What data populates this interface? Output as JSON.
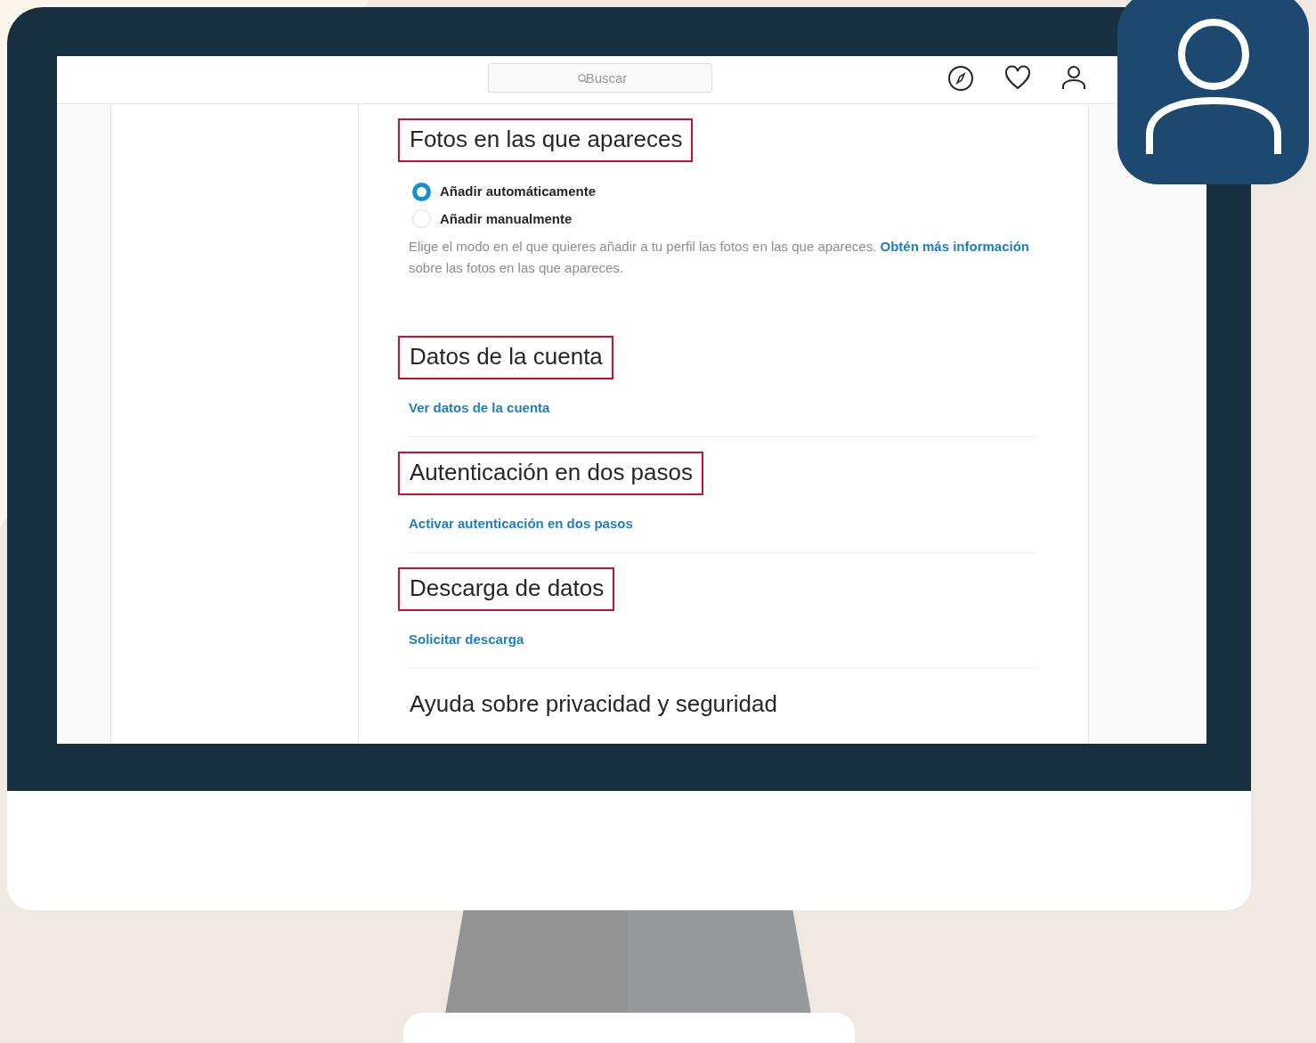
{
  "header": {
    "search": {
      "placeholder": "Buscar"
    }
  },
  "sections": [
    {
      "kind": "radio",
      "title": "Fotos en las que apareces",
      "highlighted": true,
      "options": [
        {
          "label": "Añadir automáticamente",
          "selected": true
        },
        {
          "label": "Añadir manualmente",
          "selected": false
        }
      ],
      "description": {
        "before": "Elige el modo en el que quieres añadir a tu perfil las fotos en las que apareces.",
        "link": "Obtén más información",
        "after": "sobre las fotos en las que apareces."
      }
    },
    {
      "kind": "link",
      "title": "Datos de la cuenta",
      "highlighted": true,
      "link": "Ver datos de la cuenta"
    },
    {
      "kind": "link",
      "title": "Autenticación en dos pasos",
      "highlighted": true,
      "link": "Activar autenticación en dos pasos"
    },
    {
      "kind": "link",
      "title": "Descarga de datos",
      "highlighted": true,
      "link": "Solicitar descarga"
    },
    {
      "kind": "heading",
      "title": "Ayuda sobre privacidad y seguridad",
      "highlighted": false
    }
  ]
}
